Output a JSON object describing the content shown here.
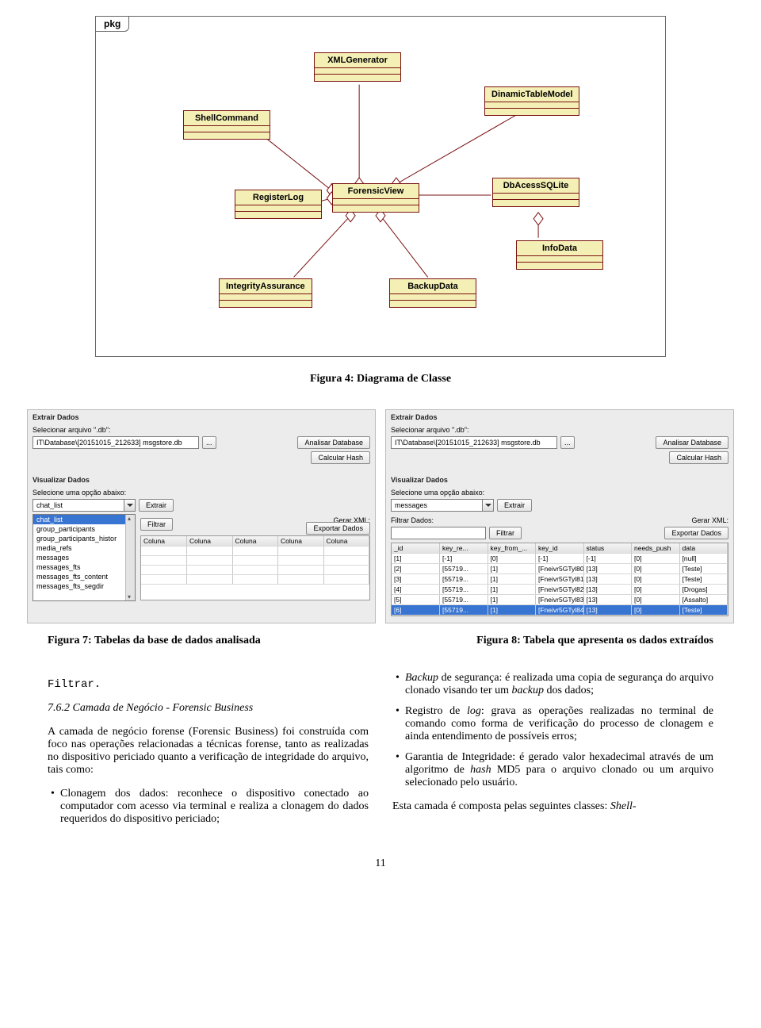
{
  "uml": {
    "pkg": "pkg",
    "classes": {
      "xmlgen": "XMLGenerator",
      "shell": "ShellCommand",
      "dintable": "DinamicTableModel",
      "reglog": "RegisterLog",
      "fview": "ForensicView",
      "dbac": "DbAcessSQLite",
      "infodata": "InfoData",
      "integ": "IntegrityAssurance",
      "backup": "BackupData"
    }
  },
  "captions": {
    "fig4": "Figura 4: Diagrama de Classe",
    "fig7": "Figura 7: Tabelas da base de dados analisada",
    "fig8": "Figura 8: Tabela que apresenta os dados extraídos"
  },
  "ui": {
    "extract": "Extrair Dados",
    "selectFile": "Selecionar arquivo \".db\":",
    "browse": "...",
    "analyze": "Analisar Database",
    "hash": "Calcular Hash",
    "filePath": "IT\\Database\\[20151015_212633] msgstore.db",
    "visualize": "Visualizar Dados",
    "selectOption": "Selecione uma opção abaixo:",
    "extractBtn": "Extrair",
    "filterLbl": "Filtrar Dados:",
    "filterBtn": "Filtrar",
    "xml": "Gerar XML:",
    "export": "Exportar Dados",
    "colLabel": "Coluna"
  },
  "leftList": {
    "selected": "chat_list",
    "items": [
      "chat_list",
      "group_participants",
      "group_participants_histor",
      "media_refs",
      "messages",
      "messages_fts",
      "messages_fts_content",
      "messages_fts_segdir"
    ]
  },
  "rightCombo": "messages",
  "tableHeaders": [
    "_id",
    "key_re...",
    "key_from_...",
    "key_id",
    "status",
    "needs_push",
    "data"
  ],
  "tableRows": [
    [
      "[1]",
      "[-1]",
      "[0]",
      "[-1]",
      "[-1]",
      "[0]",
      "[null]"
    ],
    [
      "[2]",
      "[55719...",
      "[1]",
      "[Fneivr5GTyl80]",
      "[13]",
      "[0]",
      "[Teste]"
    ],
    [
      "[3]",
      "[55719...",
      "[1]",
      "[Fneivr5GTyl81]",
      "[13]",
      "[0]",
      "[Teste]"
    ],
    [
      "[4]",
      "[55719...",
      "[1]",
      "[Fneivr5GTyl82]",
      "[13]",
      "[0]",
      "[Drogas]"
    ],
    [
      "[5]",
      "[55719...",
      "[1]",
      "[Fneivr5GTyl83]",
      "[13]",
      "[0]",
      "[Assalto]"
    ],
    [
      "[6]",
      "[55719...",
      "[1]",
      "[Fneivr5GTyl84]",
      "[13]",
      "[0]",
      "[Teste]"
    ]
  ],
  "text": {
    "filtrar": "Filtrar.",
    "sec": "7.6.2   Camada de Negócio - Forensic Business",
    "p1": "A camada de negócio forense (Forensic Business) foi construída com foco nas operações relacionadas a técnicas forense, tanto as realizadas no dispositivo periciado quanto a verificação de integridade do arquivo, tais como:",
    "li1": "Clonagem dos dados: reconhece o dispositivo conectado ao computador com acesso via terminal e realiza a clonagem do dados requeridos do dispositivo periciado;",
    "li2a": "Backup",
    "li2b": " de segurança: é realizada uma copia de segurança do arquivo clonado visando ter um ",
    "li2c": "backup",
    "li2d": " dos dados;",
    "li3a": "Registro de ",
    "li3b": "log",
    "li3c": ": grava as operações realizadas no terminal de comando como forma de verificação do processo de clonagem e ainda entendimento de possíveis erros;",
    "li4a": "Garantia de Integridade: é gerado valor hexadecimal através de um algoritmo de ",
    "li4b": "hash",
    "li4c": " MD5 para o arquivo clonado ou um arquivo selecionado pelo usuário.",
    "p2a": "Esta camada é composta pelas seguintes classes: ",
    "p2b": "Shell-",
    "page": "11"
  }
}
